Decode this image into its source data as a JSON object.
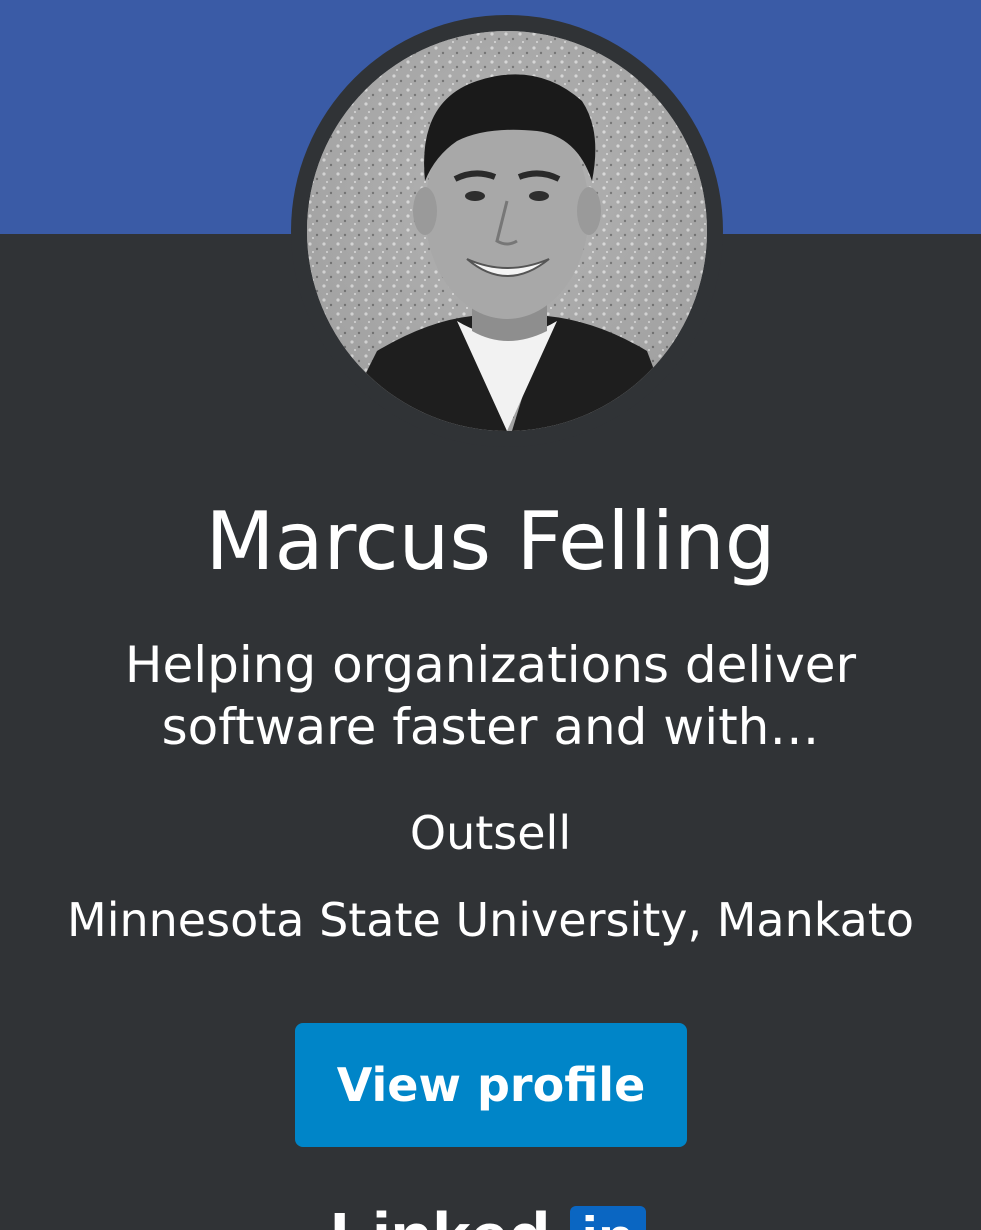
{
  "profile": {
    "name": "Marcus Felling",
    "headline": "Helping organizations deliver software faster and with…",
    "company": "Outsell",
    "school": "Minnesota State University, Mankato",
    "photo_alt": "profile-photo"
  },
  "actions": {
    "view_profile_label": "View profile"
  },
  "brand": {
    "wordmark": "Linked",
    "box": "in"
  },
  "colors": {
    "banner": "#3a5ba6",
    "background": "#303336",
    "button": "#0085c8",
    "text": "#ffffff"
  }
}
